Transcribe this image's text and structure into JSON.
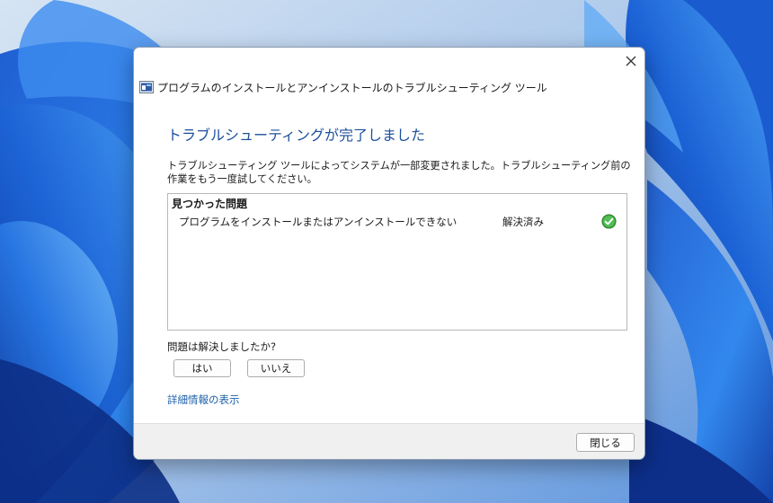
{
  "window": {
    "title": "プログラムのインストールとアンインストールのトラブルシューティング ツール",
    "close_glyph": "✕"
  },
  "content": {
    "heading": "トラブルシューティングが完了しました",
    "description": "トラブルシューティング ツールによってシステムが一部変更されました。トラブルシューティング前の作業をもう一度試してください。"
  },
  "problems": {
    "header": "見つかった問題",
    "items": [
      {
        "name": "プログラムをインストールまたはアンインストールできない",
        "status": "解決済み",
        "status_icon": "green-check-icon"
      }
    ]
  },
  "feedback": {
    "question": "問題は解決しましたか?",
    "yes_label": "はい",
    "no_label": "いいえ"
  },
  "links": {
    "details": "詳細情報の表示"
  },
  "footer": {
    "close_label": "閉じる"
  },
  "colors": {
    "heading": "#1c4f9c",
    "link": "#1c5fa8",
    "check": "#3ca53c",
    "wallpaper": "#2f6fd6"
  }
}
